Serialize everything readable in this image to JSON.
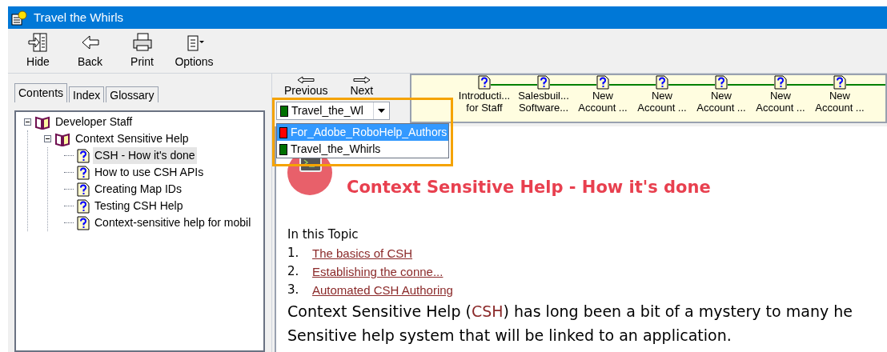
{
  "window": {
    "title": "Travel the Whirls"
  },
  "toolbar": [
    {
      "label": "Hide",
      "kind": "hide"
    },
    {
      "label": "Back",
      "kind": "back"
    },
    {
      "label": "Print",
      "kind": "print"
    },
    {
      "label": "Options",
      "kind": "options"
    }
  ],
  "tabs": [
    {
      "label": "Contents",
      "selected": true
    },
    {
      "label": "Index",
      "selected": false
    },
    {
      "label": "Glossary",
      "selected": false
    }
  ],
  "tree": [
    {
      "label": "Developer Staff",
      "kind": "book",
      "expanded": true,
      "selected": false,
      "children": [
        {
          "label": "Context Sensitive Help",
          "kind": "book",
          "expanded": true,
          "selected": false,
          "children": [
            {
              "label": "CSH - How it's done",
              "kind": "topic",
              "selected": true
            },
            {
              "label": "How to use CSH APIs",
              "kind": "topic",
              "selected": false
            },
            {
              "label": "Creating Map IDs",
              "kind": "topic",
              "selected": false
            },
            {
              "label": "Testing CSH Help",
              "kind": "topic",
              "selected": false
            },
            {
              "label": "Context-sensitive help for mobil",
              "kind": "topic",
              "selected": false
            }
          ]
        }
      ]
    }
  ],
  "nav": [
    {
      "label": "Previous",
      "kind": "previous"
    },
    {
      "label": "Next",
      "kind": "next"
    }
  ],
  "browse_sequence": [
    {
      "line1": "Introducti...",
      "line2": "for Staff"
    },
    {
      "line1": "Salesbuil...",
      "line2": "Software..."
    },
    {
      "line1": "New",
      "line2": "Account ..."
    },
    {
      "line1": "New",
      "line2": "Account ..."
    },
    {
      "line1": "New",
      "line2": "Account ..."
    },
    {
      "line1": "New",
      "line2": "Account ..."
    },
    {
      "line1": "New",
      "line2": "Account ..."
    }
  ],
  "project_select": {
    "value": "Travel_the_Wl",
    "color": "#007000",
    "options": [
      {
        "label": "For_Adobe_RoboHelp_Authors",
        "color": "#ff0000",
        "selected": true
      },
      {
        "label": "Travel_the_Whirls",
        "color": "#007000",
        "selected": false
      }
    ]
  },
  "content": {
    "heading": "Context Sensitive Help - How it's done",
    "toc_title": "In this Topic",
    "toc": [
      {
        "number": "1.",
        "label": "The basics of CSH"
      },
      {
        "number": "2.",
        "label": "Establishing the conne..."
      },
      {
        "number": "3.",
        "label": "Automated CSH Authoring"
      }
    ],
    "paragraph": {
      "before": "Context Sensitive Help (",
      "link": "CSH",
      "after": ") has long been a bit of a mystery to many he Sensitive help system that will be linked to an application."
    }
  }
}
